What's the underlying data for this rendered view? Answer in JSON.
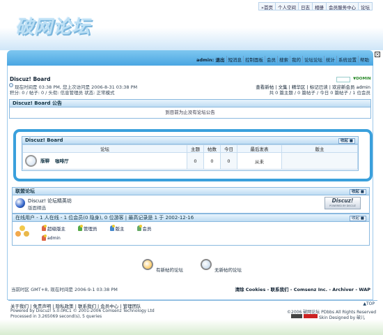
{
  "topbar": {
    "items": [
      "»首页",
      "个人空间",
      "日志",
      "相册",
      "会员服务中心",
      "论坛"
    ]
  },
  "logo": {
    "text": "破网论坛"
  },
  "nav": {
    "items": [
      "admin: 退出",
      "短消息",
      "控制面板",
      "会员",
      "搜索",
      "我的",
      "论坛论坛",
      "统计",
      "系统设置",
      "帮助"
    ]
  },
  "crumb": {
    "title": "Discuz! Board",
    "info": "现在时间是 03:38 PM, 您上次访问是 2006-8-31 03:38 PM",
    "info2": "积分: 0 / 帖子: 0 / 头衔: 信息管理员 状态: 正常模式",
    "links": "查看新帖 | 文集 | 精华区 | 标记已读 | 欢迎新会员 admin",
    "stats": "共 0 篇主题 / 0 篇帖子 / 今日 0 篇帖子 / 1 位会员",
    "domain": "▼DOMIN"
  },
  "notice": {
    "header": "Discuz! Board 公告",
    "body": "到目前为止没有论坛公告"
  },
  "forum": {
    "header": "Discuz! Board",
    "collapse": "收起 ■",
    "cols": [
      "论坛",
      "主题",
      "帖数",
      "今日",
      "最后发表",
      "版主"
    ],
    "row": {
      "name": "版聊",
      "desc": "咖啡厅",
      "topics": "0",
      "posts": "0",
      "today": "0",
      "last": "从未",
      "mod": ""
    }
  },
  "partners": {
    "header": "联盟论坛",
    "collapse": "收起 ■",
    "name": "Discuz! 论坛精英坊",
    "desc": "版面精选",
    "badge": "Discuz!",
    "badge_sub": "POWERED BY DISCUZ"
  },
  "online": {
    "header": "在线用户 - 1 人在线 - 1 位会员(0 隐身), 0 位游客 | 最高记录是 1 于 2002-12-16",
    "collapse": "收起 ■",
    "legend": [
      "超级版主",
      "管理员",
      "版主",
      "会员",
      "游客"
    ],
    "user": "admin"
  },
  "legend_icons": {
    "new": "有新帖的论坛",
    "nonew": "无新帖的论坛"
  },
  "footer": {
    "time": "当前时区 GMT+8, 现在时间是 2006-9-1 03:38 PM",
    "links": "清除 Cookies - 联系我们 - Comsenz Inc. - Archiver - WAP",
    "bottom_links": "关于我们 | 免责声明 | 隐私政策 | 联系我们 | 会员中心 | 管理团队",
    "powered": "Powered by Discuz! 5.0.0RC1 © 2001-2006 Comsenz Technology Ltd",
    "processed": "Processed in 3.265069 second(s), 5 queries",
    "copy": "©2006 破网论坛 PDbbs All Rights Reserved",
    "skin": "Skin Designed by 破儿",
    "top": "▲TOP"
  },
  "colors": {
    "accent": "#4aa6e2",
    "header": "#bfdcf3",
    "frame": "#3aa0dc"
  }
}
